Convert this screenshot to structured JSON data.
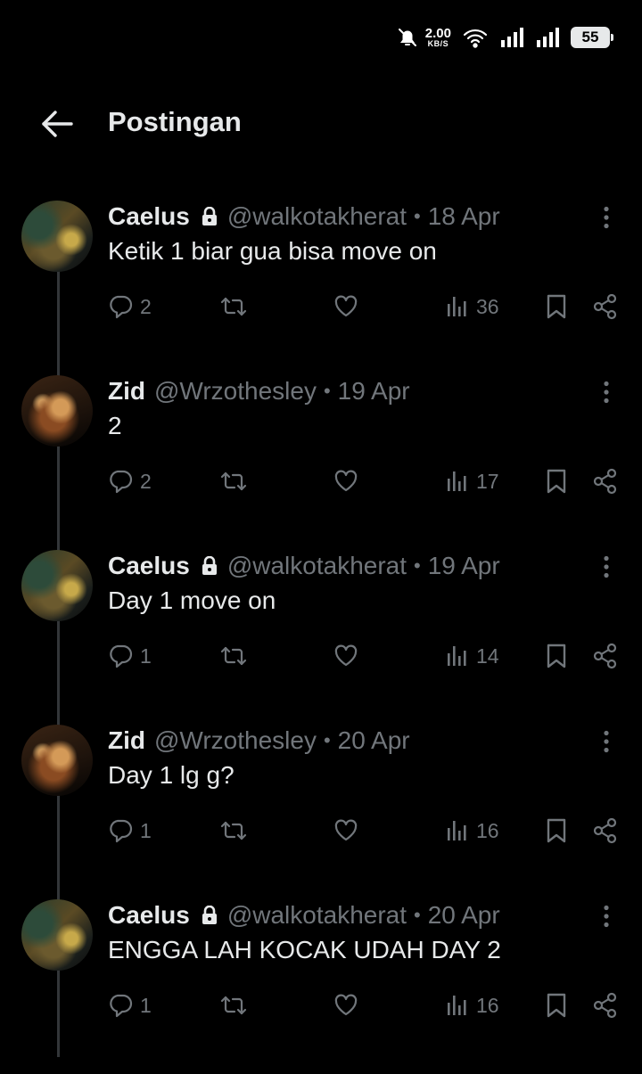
{
  "status_bar": {
    "speed_value": "2.00",
    "speed_unit": "KB/S",
    "battery": "55"
  },
  "header": {
    "title": "Postingan"
  },
  "posts": [
    {
      "name": "Caelus",
      "locked": true,
      "handle": "@walkotakherat",
      "date": "18 Apr",
      "text": "Ketik 1 biar gua bisa move on",
      "replies": "2",
      "views": "36",
      "avatar": "caelus"
    },
    {
      "name": "Zid",
      "locked": false,
      "handle": "@Wrzothesley",
      "date": "19 Apr",
      "text": "2",
      "replies": "2",
      "views": "17",
      "avatar": "zid"
    },
    {
      "name": "Caelus",
      "locked": true,
      "handle": "@walkotakherat",
      "date": "19 Apr",
      "text": "Day 1 move on",
      "replies": "1",
      "views": "14",
      "avatar": "caelus"
    },
    {
      "name": "Zid",
      "locked": false,
      "handle": "@Wrzothesley",
      "date": "20 Apr",
      "text": "Day 1 lg g?",
      "replies": "1",
      "views": "16",
      "avatar": "zid"
    },
    {
      "name": "Caelus",
      "locked": true,
      "handle": "@walkotakherat",
      "date": "20 Apr",
      "text": "ENGGA LAH KOCAK UDAH DAY 2",
      "replies": "1",
      "views": "16",
      "avatar": "caelus"
    }
  ],
  "separator": "•",
  "colors": {
    "background": "#000000",
    "text": "#e7e9ea",
    "muted": "#71767b"
  }
}
